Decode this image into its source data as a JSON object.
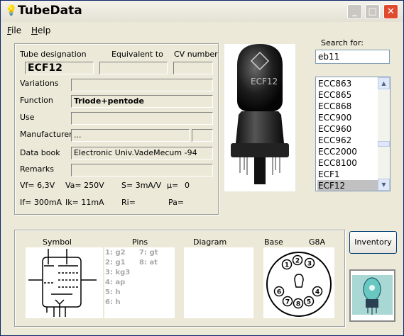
{
  "window": {
    "title": "TubeData",
    "title_icon": "lightbulb-icon"
  },
  "menu": {
    "file": "File",
    "help": "Help"
  },
  "header": {
    "tube_designation": "Tube designation",
    "equivalent_to": "Equivalent to",
    "cv_number": "CV number"
  },
  "tube": {
    "designation": "ECF12",
    "equivalent": "",
    "cv": "",
    "variations": "",
    "function": "Triode+pentode",
    "use": "",
    "manufacturer": "...",
    "manufacturer_extra": "",
    "data_book": "Electronic Univ.VadeMecum -94",
    "remarks": ""
  },
  "labels": {
    "variations": "Variations",
    "function": "Function",
    "use": "Use",
    "manufacturer": "Manufacturer",
    "data_book": "Data book",
    "remarks": "Remarks"
  },
  "params": {
    "vf": "Vf= 6,3V",
    "va": "Va= 250V",
    "s": "S= 3mA/V",
    "mu_label": "µ=",
    "mu_value": "0",
    "if": "If= 300mA",
    "ik": "Ik= 11mA",
    "ri": "Ri=",
    "pa": "Pa="
  },
  "photo": {
    "glass_text": "ECF12"
  },
  "search": {
    "label": "Search for:",
    "value": "eb11"
  },
  "tube_list": {
    "items": [
      "ECC863",
      "ECC865",
      "ECC868",
      "ECC900",
      "ECC960",
      "ECC962",
      "ECC2000",
      "ECC8100",
      "ECF1",
      "ECF12"
    ],
    "selected": "ECF12"
  },
  "bottom": {
    "symbol": "Symbol",
    "pins": "Pins",
    "diagram": "Diagram",
    "base": "Base",
    "base_type": "G8A"
  },
  "pins": {
    "col1": [
      "1: g2",
      "2: g1",
      "3: kg3",
      "4: ap",
      "5: h",
      "6: h"
    ],
    "col2": [
      "7: gt",
      "8: at"
    ]
  },
  "base_pins": [
    "1",
    "2",
    "3",
    "4",
    "5",
    "6",
    "7",
    "8"
  ],
  "inventory_button": "Inventory",
  "colors": {
    "title_close": "#e04b2f",
    "selection": "#c1c1c1",
    "window_bg": "#ece9d8"
  }
}
